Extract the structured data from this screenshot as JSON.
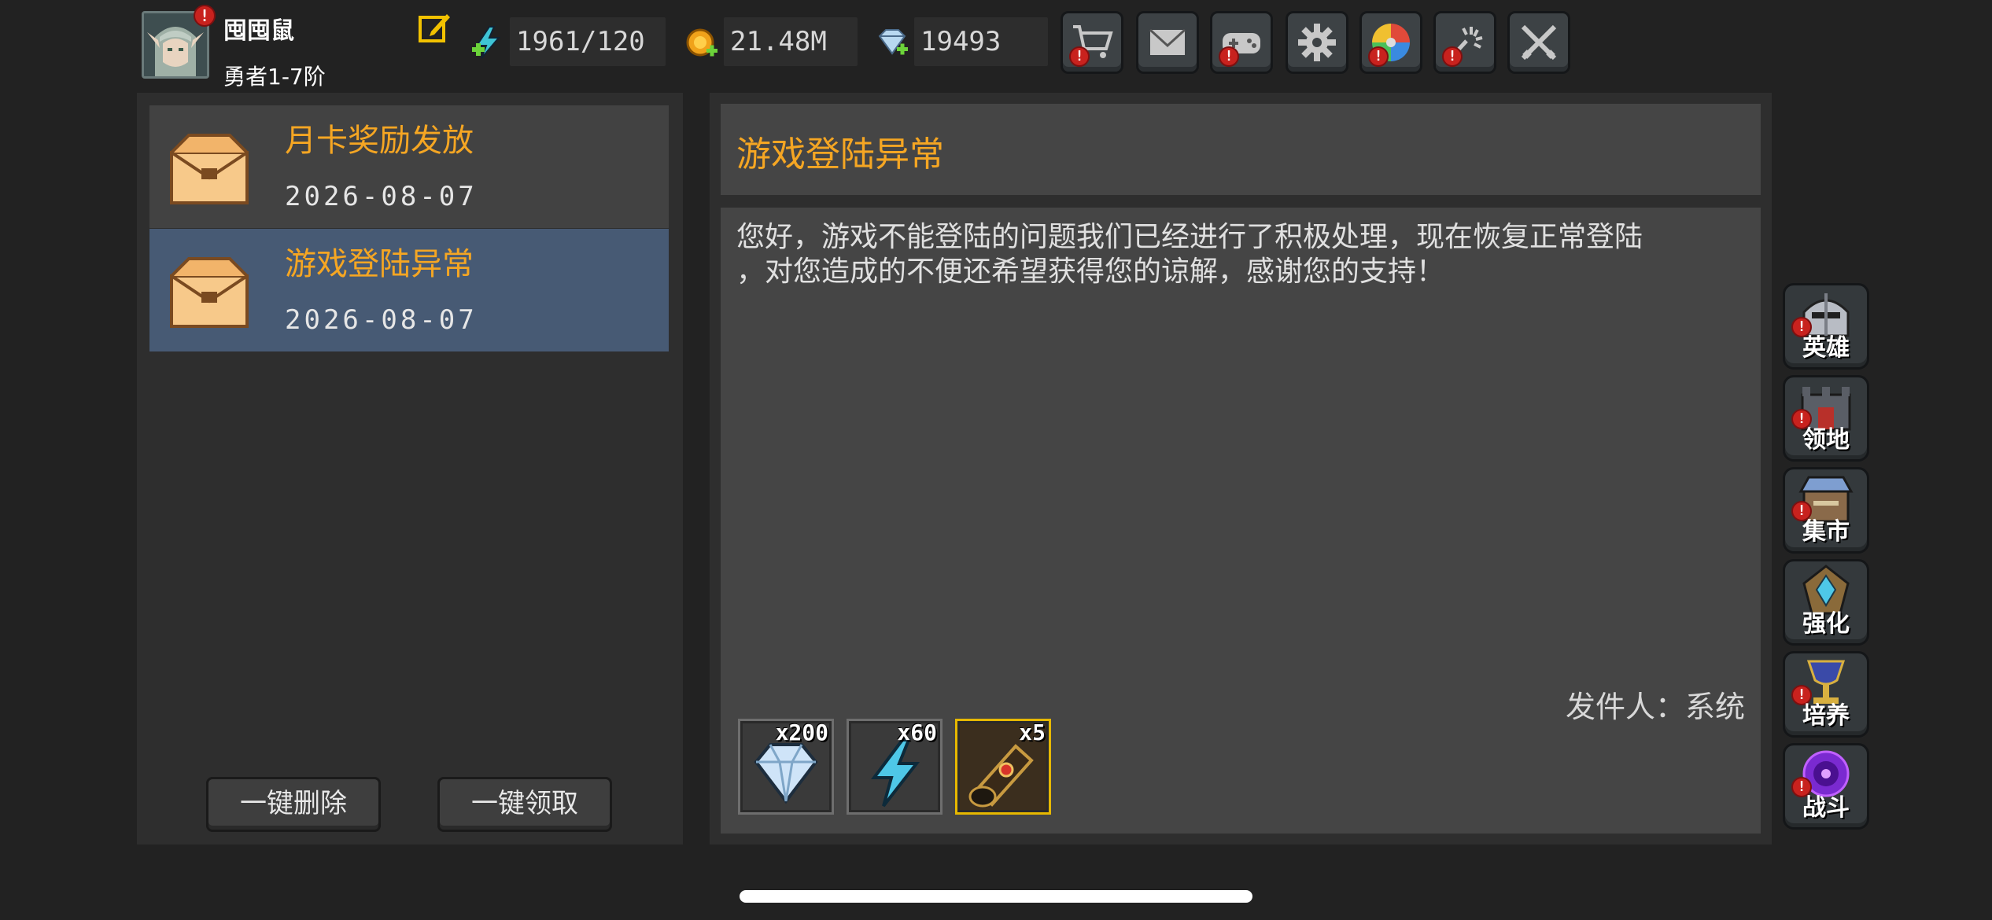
{
  "header": {
    "player_name": "囤囤鼠",
    "player_rank": "勇者1-7阶",
    "avatar_badge": "!",
    "energy": "1961/120",
    "gold": "21.48M",
    "gems": "19493"
  },
  "toolbar": {
    "buttons": [
      {
        "icon": "shop-cart-icon",
        "badge": "!"
      },
      {
        "icon": "mail-icon",
        "badge": ""
      },
      {
        "icon": "gamepad-icon",
        "badge": "!"
      },
      {
        "icon": "gear-icon",
        "badge": ""
      },
      {
        "icon": "color-wheel-icon",
        "badge": "!"
      },
      {
        "icon": "fireworks-icon",
        "badge": "!"
      },
      {
        "icon": "crossed-swords-icon",
        "badge": ""
      }
    ]
  },
  "mail_list": [
    {
      "title": "月卡奖励发放",
      "date": "2026-08-07",
      "selected": false
    },
    {
      "title": "游戏登陆异常",
      "date": "2026-08-07",
      "selected": true
    }
  ],
  "actions": {
    "delete_all": "一键删除",
    "claim_all": "一键领取"
  },
  "detail": {
    "title": "游戏登陆异常",
    "body": "您好，游戏不能登陆的问题我们已经进行了积极处理，现在恢复正常登陆\n，对您造成的不便还希望获得您的谅解，感谢您的支持！",
    "sender": "发件人：系统",
    "attachments": [
      {
        "item": "diamond",
        "qty": "x200"
      },
      {
        "item": "lightning",
        "qty": "x60"
      },
      {
        "item": "scroll",
        "qty": "x5"
      }
    ]
  },
  "side_nav": [
    {
      "label": "英雄",
      "badge": "!"
    },
    {
      "label": "领地",
      "badge": "!"
    },
    {
      "label": "集市",
      "badge": "!"
    },
    {
      "label": "强化",
      "badge": ""
    },
    {
      "label": "培养",
      "badge": "!"
    },
    {
      "label": "战斗",
      "badge": "!"
    }
  ],
  "colors": {
    "accent_orange": "#f5a623",
    "selected_row": "#475a74",
    "badge_red": "#c8221e"
  }
}
